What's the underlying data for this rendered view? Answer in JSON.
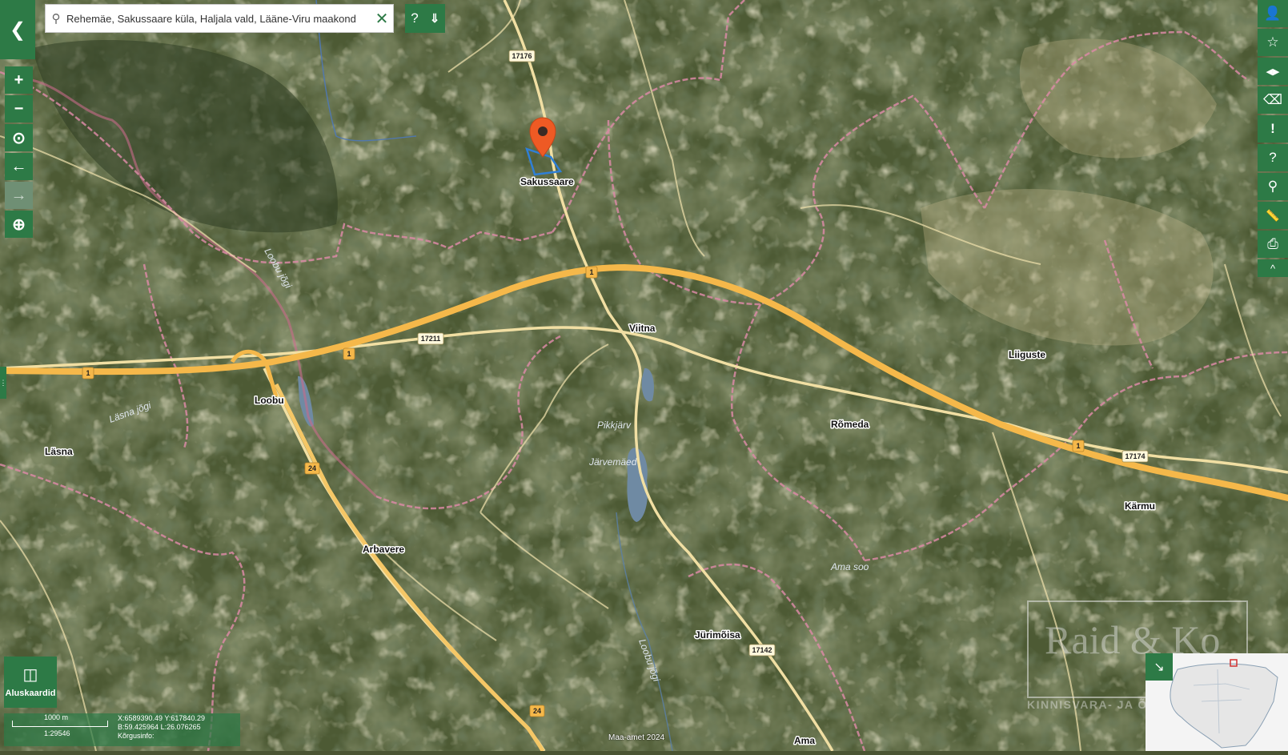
{
  "search": {
    "value": "Rehemäe, Sakussaare küla, Haljala vald, Lääne-Viru maakond",
    "help_label": "?",
    "expand_icon": "double-chevron-down-icon"
  },
  "colors": {
    "ui_green": "#2d7a46",
    "highway": "#f5b84a",
    "road": "#f1dfa3",
    "boundary": "#d98aa5",
    "marker": "#ee5a24",
    "parcel": "#3a8ee6"
  },
  "left_toolbar": [
    {
      "name": "zoom-in",
      "icon": "plus-icon",
      "glyph": "+"
    },
    {
      "name": "zoom-out",
      "icon": "minus-icon",
      "glyph": "−"
    },
    {
      "name": "locate",
      "icon": "target-icon",
      "glyph": "⊙"
    },
    {
      "name": "back",
      "icon": "arrow-left-icon",
      "glyph": "←"
    },
    {
      "name": "forward",
      "icon": "arrow-right-icon",
      "glyph": "→"
    },
    {
      "name": "north",
      "icon": "compass-icon",
      "glyph": "⊕"
    }
  ],
  "right_toolbar": [
    {
      "name": "account",
      "icon": "user-icon",
      "glyph": "👤"
    },
    {
      "name": "favorites",
      "icon": "star-icon",
      "glyph": "☆"
    },
    {
      "name": "compare",
      "icon": "split-view-icon",
      "glyph": "◀▶"
    },
    {
      "name": "eraser",
      "icon": "eraser-icon",
      "glyph": "⌫"
    },
    {
      "name": "feedback",
      "icon": "comment-icon",
      "glyph": "!"
    },
    {
      "name": "help",
      "icon": "question-icon",
      "glyph": "?"
    },
    {
      "name": "place-marker",
      "icon": "pin-icon",
      "glyph": "⚲"
    },
    {
      "name": "measure",
      "icon": "ruler-icon",
      "glyph": "📏"
    },
    {
      "name": "print",
      "icon": "printer-icon",
      "glyph": "⎙"
    },
    {
      "name": "collapse",
      "icon": "chevron-up-icon",
      "glyph": "^"
    }
  ],
  "place_labels": [
    {
      "name": "Sakussaare"
    },
    {
      "name": "Viitna"
    },
    {
      "name": "Loobu"
    },
    {
      "name": "Läsna"
    },
    {
      "name": "Arbavere"
    },
    {
      "name": "Rõmeda"
    },
    {
      "name": "Liiguste"
    },
    {
      "name": "Kärmu"
    },
    {
      "name": "Jürimõisa"
    },
    {
      "name": "Ama"
    }
  ],
  "feature_labels": [
    {
      "name": "Loobu jõgi"
    },
    {
      "name": "Läsna jõgi"
    },
    {
      "name": "Pikkjärv"
    },
    {
      "name": "Järvemäed"
    },
    {
      "name": "Ama soo"
    },
    {
      "name": "Loobu jõgi"
    }
  ],
  "road_numbers": [
    "17176",
    "1",
    "17211",
    "1",
    "1",
    "24",
    "24",
    "1",
    "17174",
    "17142"
  ],
  "basemap": {
    "label": "Aluskaardid",
    "icon": "map-icon"
  },
  "scale": {
    "length": "1000 m",
    "ratio": "1:29546",
    "x": "X:6589390.49",
    "y": "Y:617840.29",
    "b": "B:59.425964",
    "l": "L:26.076265",
    "height_label": "Kõrgusinfo:"
  },
  "copyright": "Maa-amet 2024",
  "watermark": {
    "name": "Raid & Ko",
    "subtitle": "KINNISVARA- JA ÕIGUSBÜROO"
  },
  "overview": {
    "expand_icon": "expand-arrow-icon"
  }
}
